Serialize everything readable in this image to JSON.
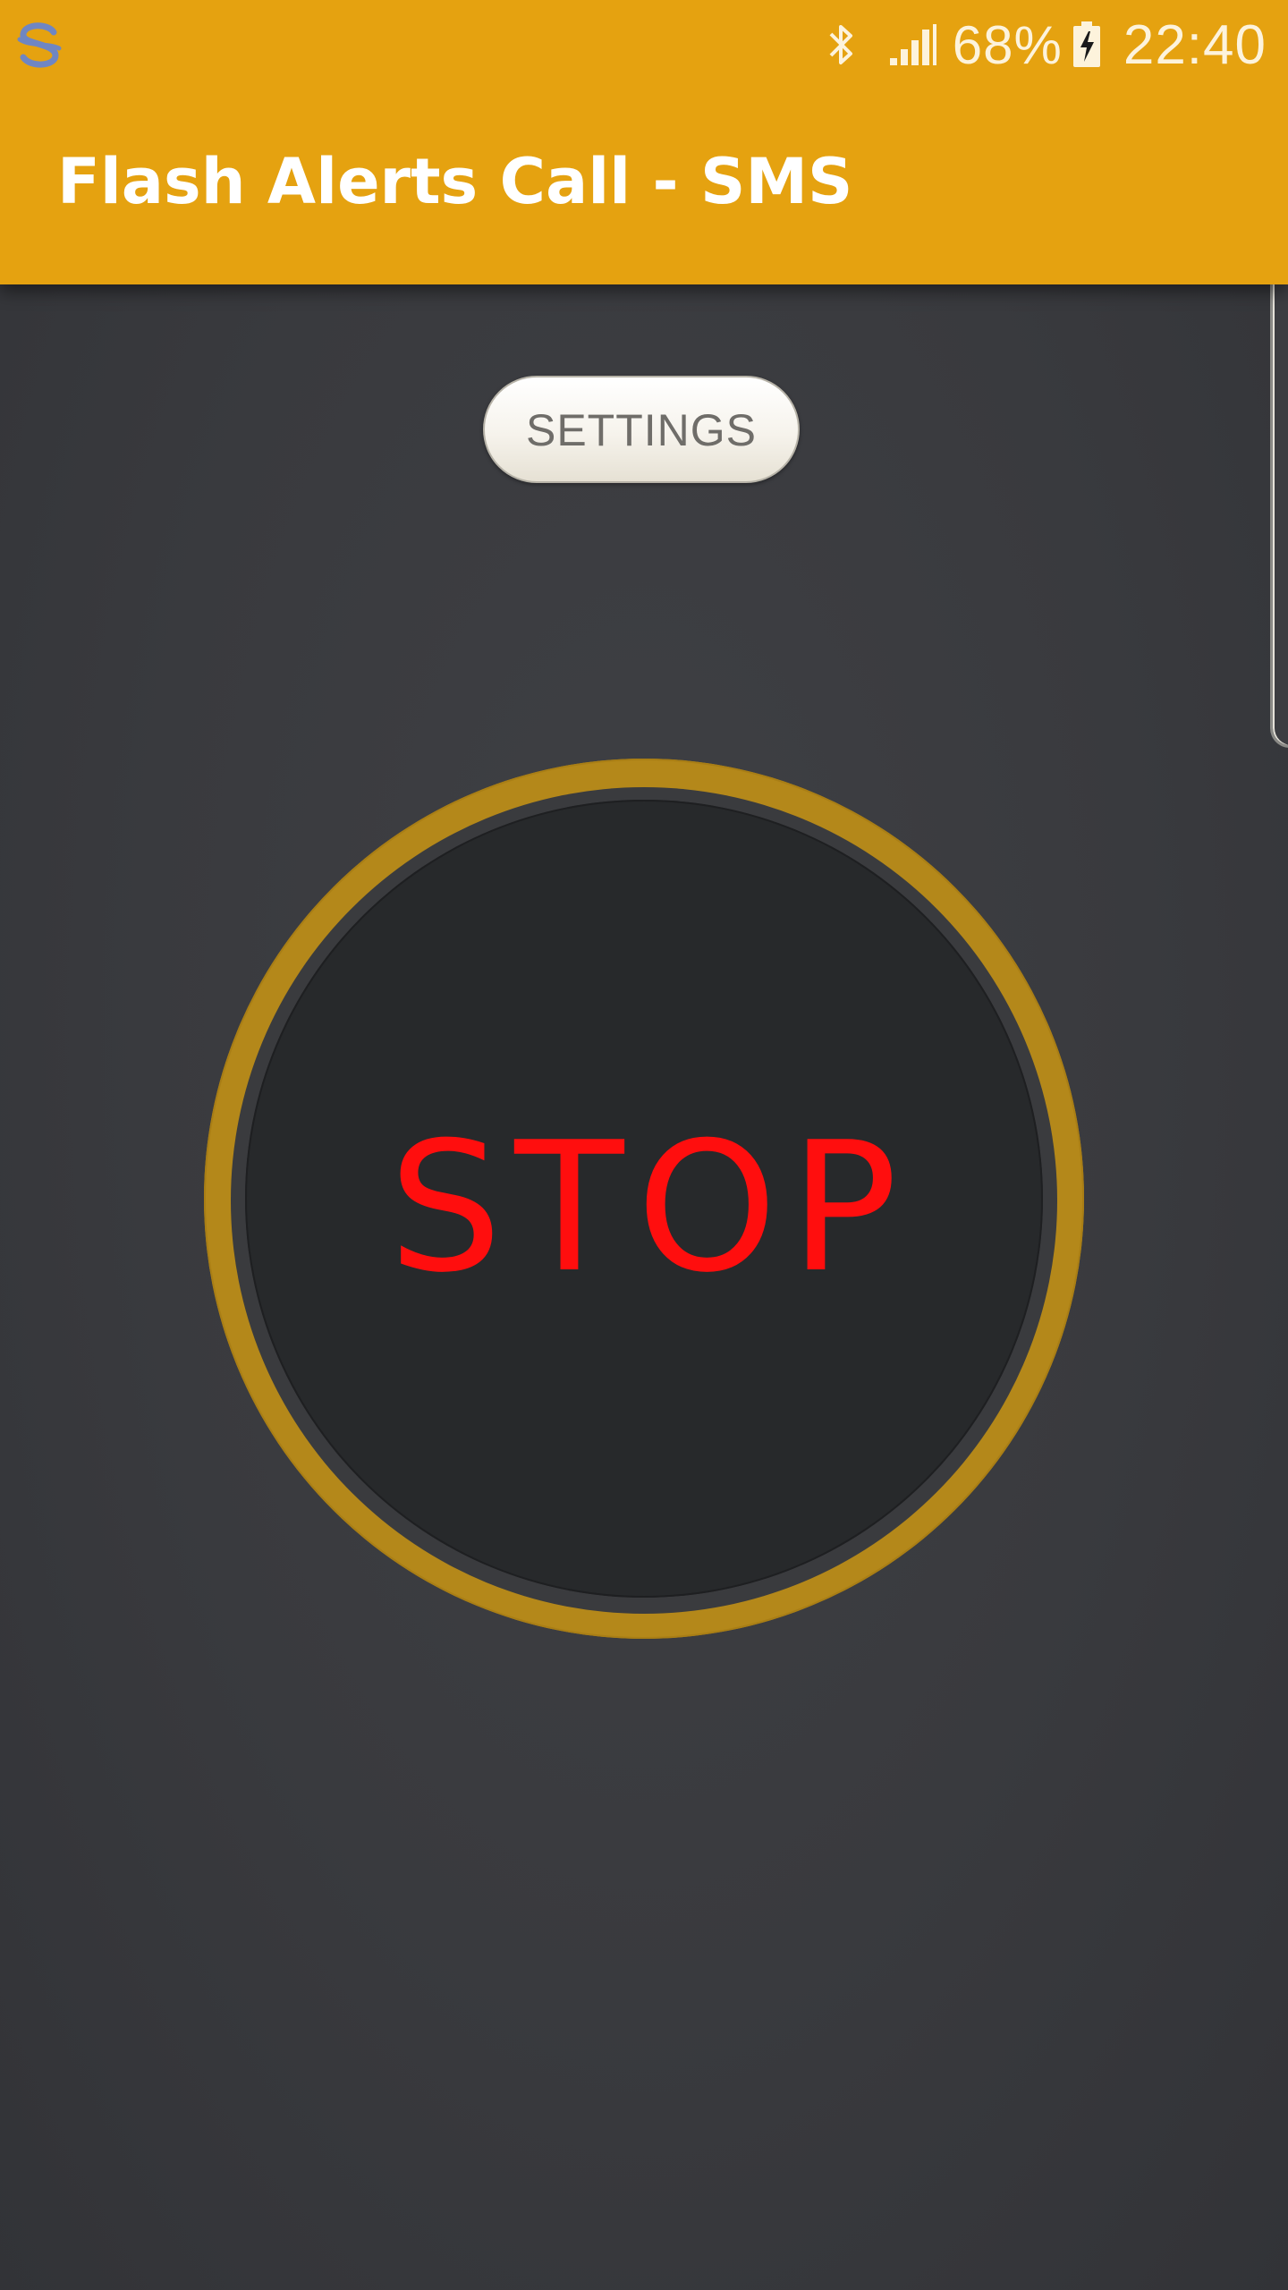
{
  "status_bar": {
    "app_notification_icon": "sync-s-icon",
    "bluetooth_icon": "bluetooth-icon",
    "signal_icon": "cell-signal-icon",
    "battery_percent": "68%",
    "battery_icon": "battery-charging-icon",
    "time": "22:40"
  },
  "app_bar": {
    "title": "Flash Alerts Call - SMS",
    "color": "#e5a210"
  },
  "main": {
    "settings_button_label": "SETTINGS",
    "stop_button_label": "STOP",
    "stop_label_color": "#ff0e0e",
    "ring_color": "#b4881a"
  }
}
